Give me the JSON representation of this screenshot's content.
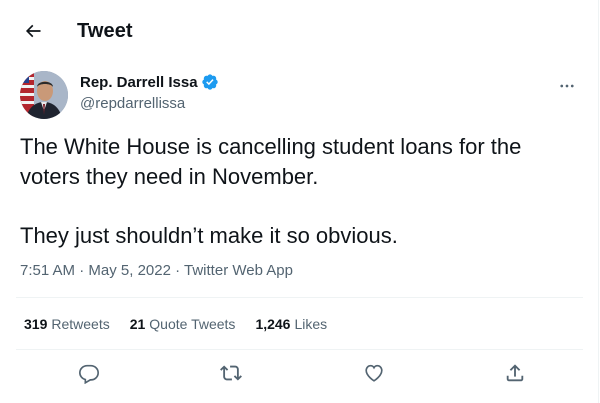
{
  "header": {
    "title": "Tweet",
    "back_icon": "arrow-left-icon"
  },
  "author": {
    "display_name": "Rep. Darrell Issa",
    "handle": "@repdarrellissa",
    "verified_icon": "verified-badge-icon",
    "verified_color": "#1d9bf0",
    "more_icon": "more-horizontal-icon"
  },
  "tweet": {
    "paragraphs": [
      "The White House is cancelling student loans for the voters they need in November.",
      "They just shouldn’t make it so obvious."
    ],
    "time": "7:51 AM",
    "separator": " · ",
    "date": "May 5, 2022",
    "source": "Twitter Web App"
  },
  "stats": {
    "retweets_count": "319",
    "retweets_label": "Retweets",
    "quotes_count": "21",
    "quotes_label": "Quote Tweets",
    "likes_count": "1,246",
    "likes_label": "Likes"
  },
  "actions": [
    "reply-icon",
    "retweet-icon",
    "like-icon",
    "share-icon"
  ],
  "colors": {
    "text": "#0f1419",
    "secondary": "#536471",
    "border": "#eff3f4",
    "accent": "#1d9bf0"
  }
}
